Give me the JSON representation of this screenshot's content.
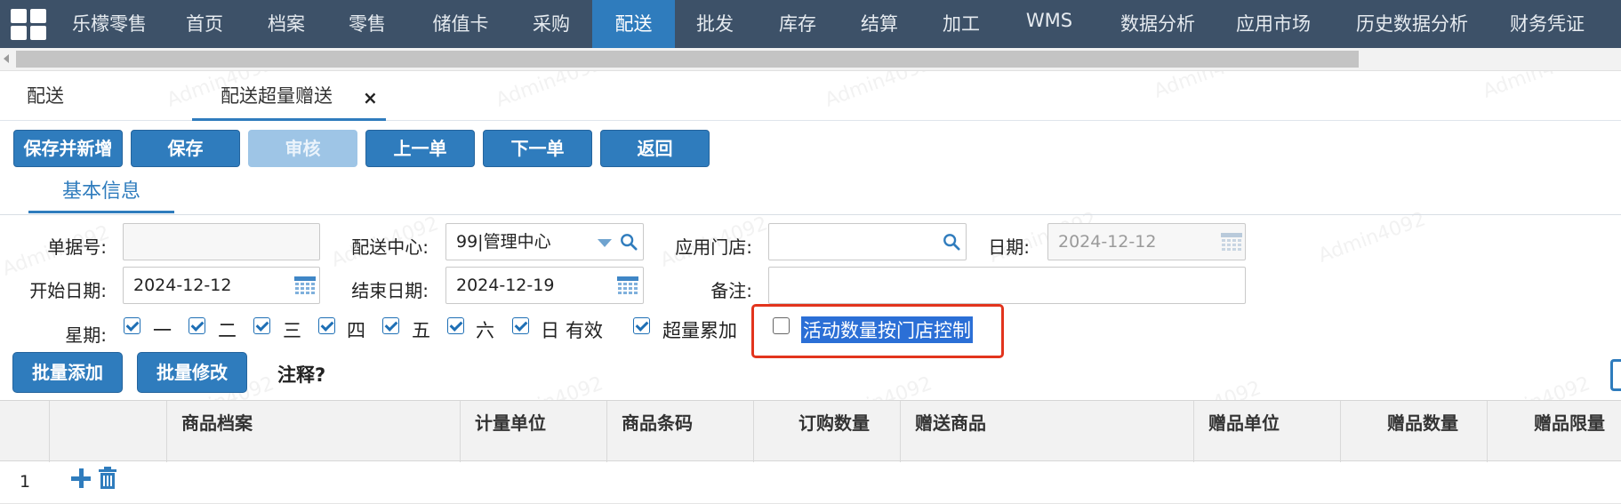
{
  "nav": {
    "items": [
      "乐檬零售",
      "首页",
      "档案",
      "零售",
      "储值卡",
      "采购",
      "配送",
      "批发",
      "库存",
      "结算",
      "加工",
      "WMS",
      "数据分析",
      "应用市场",
      "历史数据分析",
      "财务凭证"
    ],
    "active": "配送"
  },
  "tabs": [
    {
      "label": "配送"
    },
    {
      "label": "配送超量赠送",
      "close": "×"
    }
  ],
  "toolbar": {
    "save_new": "保存并新增",
    "save": "保存",
    "audit": "审核",
    "prev": "上一单",
    "next": "下一单",
    "back": "返回"
  },
  "subtab": "基本信息",
  "form": {
    "doc_no": {
      "label": "单据号:",
      "value": ""
    },
    "center": {
      "label": "配送中心:",
      "value": "99|管理中心"
    },
    "store": {
      "label": "应用门店:",
      "value": ""
    },
    "date": {
      "label": "日期:",
      "value": "2024-12-12"
    },
    "start": {
      "label": "开始日期:",
      "value": "2024-12-12"
    },
    "end": {
      "label": "结束日期:",
      "value": "2024-12-19"
    },
    "remark": {
      "label": "备注:",
      "value": ""
    },
    "week_label": "星期:",
    "weekdays": [
      {
        "label": "一",
        "checked": true
      },
      {
        "label": "二",
        "checked": true
      },
      {
        "label": "三",
        "checked": true
      },
      {
        "label": "四",
        "checked": true
      },
      {
        "label": "五",
        "checked": true
      },
      {
        "label": "六",
        "checked": true
      },
      {
        "label": "日",
        "checked": true
      }
    ],
    "valid": "有效",
    "accumulate": {
      "label": "超量累加",
      "checked": true
    },
    "store_control": {
      "label": "活动数量按门店控制",
      "checked": false
    }
  },
  "actions": {
    "batch_add": "批量添加",
    "batch_edit": "批量修改",
    "note": "注释?"
  },
  "table": {
    "columns": [
      "商品档案",
      "计量单位",
      "商品条码",
      "订购数量",
      "赠送商品",
      "赠品单位",
      "赠品数量",
      "赠品限量"
    ],
    "rows": [
      {
        "index": "1"
      }
    ]
  },
  "watermark": "Admin4092",
  "colors": {
    "nav_bg": "#3d5168",
    "accent": "#2f7cbd",
    "highlight_border": "#e2341d"
  }
}
